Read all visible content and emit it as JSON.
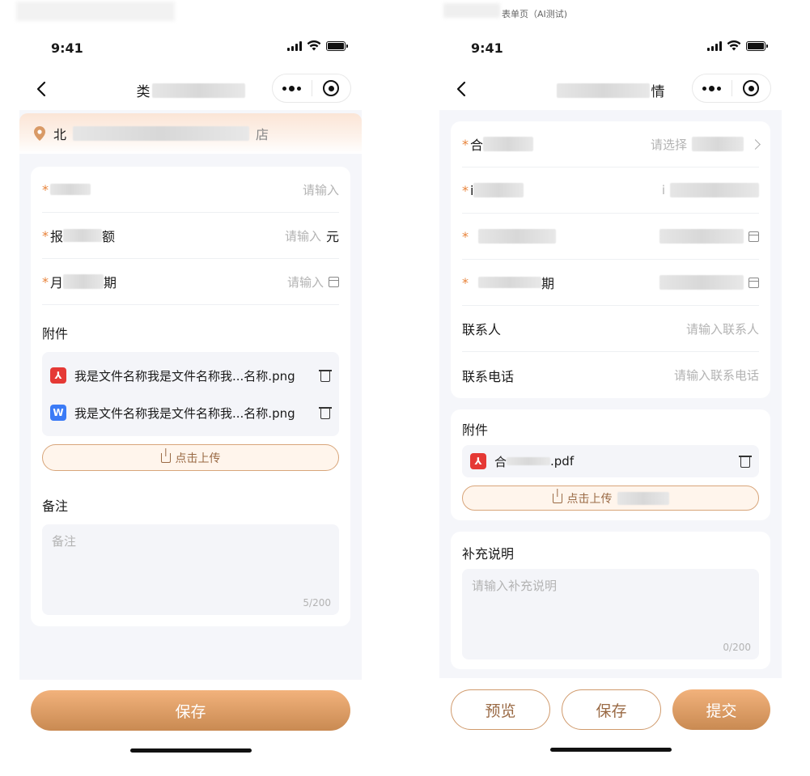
{
  "caption": "表单页（AI测试)",
  "status": {
    "time": "9:41"
  },
  "left": {
    "title_start": "类",
    "location_start": "北",
    "location_end": "店",
    "fields": [
      {
        "label_start": "",
        "label_end": "",
        "placeholder": "请输入",
        "unit": ""
      },
      {
        "label_start": "报",
        "label_end": "额",
        "placeholder": "请输入",
        "unit": "元"
      },
      {
        "label_start": "月",
        "label_end": "期",
        "placeholder": "请输入",
        "unit": ""
      }
    ],
    "attachments_title": "附件",
    "attachments": [
      {
        "icon": "pdf-icon",
        "name": "我是文件名称我是文件名称我...名称.png"
      },
      {
        "icon": "word-icon",
        "name": "我是文件名称我是文件名称我...名称.png"
      }
    ],
    "upload_label": "点击上传",
    "remark_title": "备注",
    "remark_placeholder": "备注",
    "remark_counter": "5/200",
    "save_label": "保存"
  },
  "right": {
    "title_end": "情",
    "fields": [
      {
        "label_start": "合",
        "placeholder": "请选择"
      },
      {
        "label_start": "i",
        "placeholder": "i"
      },
      {
        "label_start": "",
        "placeholder": ""
      },
      {
        "label_start": "",
        "label_end": "期",
        "placeholder": ""
      },
      {
        "label": "联系人",
        "placeholder": "请输入联系人"
      },
      {
        "label": "联系电话",
        "placeholder": "请输入联系电话"
      }
    ],
    "attachments_title": "附件",
    "attachment": {
      "icon": "pdf-icon",
      "name_start": "合",
      "name_end": ".pdf"
    },
    "upload_label": "点击上传",
    "notes_title": "补充说明",
    "notes_placeholder": "请输入补充说明",
    "notes_counter": "0/200",
    "preview_label": "预览",
    "save_label": "保存",
    "submit_label": "提交"
  },
  "colors": {
    "accent": "#e8833a",
    "button_gradient_top": "#f2b27c",
    "button_gradient_bottom": "#c98a52",
    "outline": "#d09a6c"
  }
}
